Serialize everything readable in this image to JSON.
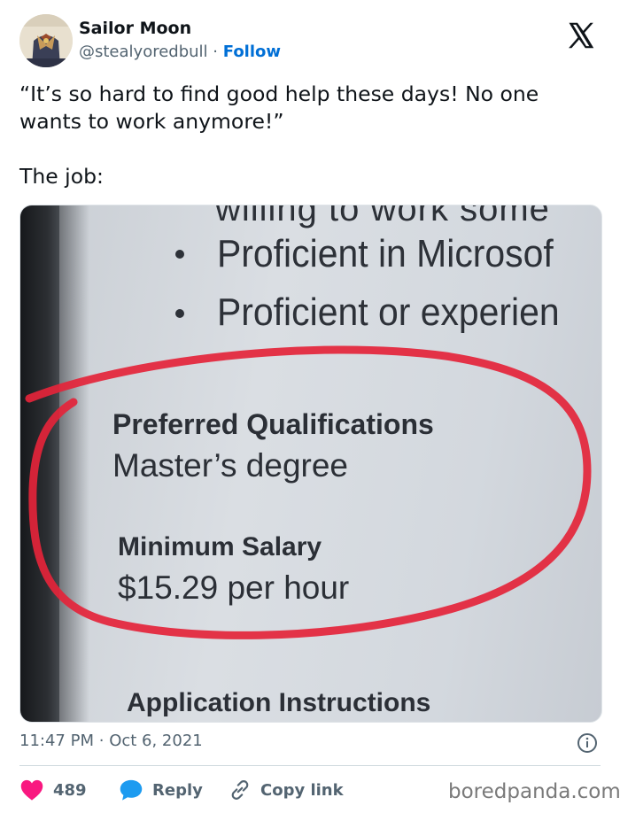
{
  "author": {
    "display_name": "Sailor Moon",
    "handle": "@stealyoredbull",
    "separator": "·",
    "follow_label": "Follow"
  },
  "tweet": {
    "line1": "“It’s so hard to find good help these days! No one wants to work anymore!”",
    "line2": "The job:"
  },
  "media": {
    "cut_top_line": "willing to work some",
    "bullets": [
      "Proficient in Microsof",
      "Proficient or experien"
    ],
    "preferred_heading": "Preferred Qualifications",
    "preferred_value": "Master’s degree",
    "salary_heading": "Minimum Salary",
    "salary_value": "$15.29 per hour",
    "instructions_heading": "Application Instructions",
    "circle_color": "#e4243a"
  },
  "meta": {
    "time": "11:47 PM",
    "separator": "·",
    "date": "Oct 6, 2021"
  },
  "actions": {
    "likes": "489",
    "reply_label": "Reply",
    "copy_label": "Copy link"
  },
  "watermark": "boredpanda.com",
  "colors": {
    "link_blue": "#006fd6",
    "like_red": "#f91880",
    "reply_blue": "#1d9bf0",
    "muted_gray": "#536471"
  }
}
